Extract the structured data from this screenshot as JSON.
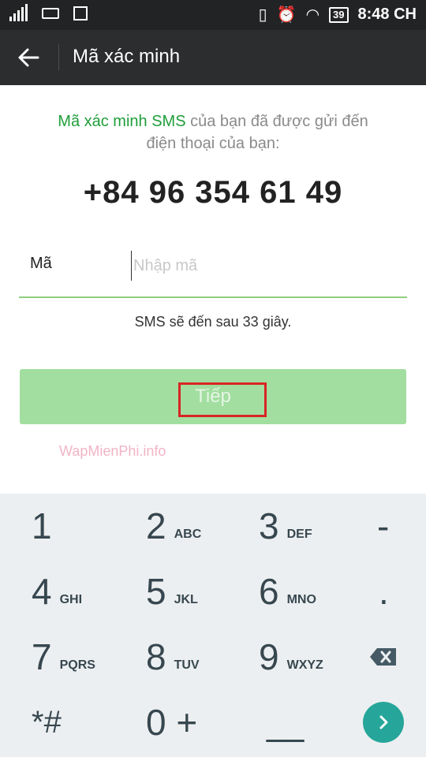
{
  "status_bar": {
    "battery": "39",
    "time": "8:48 CH"
  },
  "app_bar": {
    "title": "Mã xác minh"
  },
  "content": {
    "info_green": "Mã xác minh SMS",
    "info_rest": " của bạn đã được gửi đến",
    "info_line2": "điện thoại của bạn:",
    "phone": "+84 96 354 61 49",
    "code_label": "Mã",
    "code_placeholder": "Nhập mã",
    "sms_note": "SMS sẽ đến sau 33 giây.",
    "next_label": "Tiếp",
    "watermark": "WapMienPhi.info"
  },
  "keypad": {
    "keys": [
      {
        "n": "1",
        "l": ""
      },
      {
        "n": "2",
        "l": "ABC"
      },
      {
        "n": "3",
        "l": "DEF"
      },
      {
        "n": "-",
        "l": ""
      },
      {
        "n": "4",
        "l": "GHI"
      },
      {
        "n": "5",
        "l": "JKL"
      },
      {
        "n": "6",
        "l": "MNO"
      },
      {
        "n": ".",
        "l": ""
      },
      {
        "n": "7",
        "l": "PQRS"
      },
      {
        "n": "8",
        "l": "TUV"
      },
      {
        "n": "9",
        "l": "WXYZ"
      },
      {
        "n": "*#",
        "l": ""
      },
      {
        "n": "0 +",
        "l": ""
      },
      {
        "n": "__",
        "l": ""
      }
    ]
  },
  "colors": {
    "accent": "#1f9e3a",
    "button": "#a2dea0",
    "go": "#26a69a",
    "highlight": "#d92424"
  },
  "icons": [
    "back-arrow-icon",
    "backspace-icon",
    "next-arrow-icon"
  ]
}
